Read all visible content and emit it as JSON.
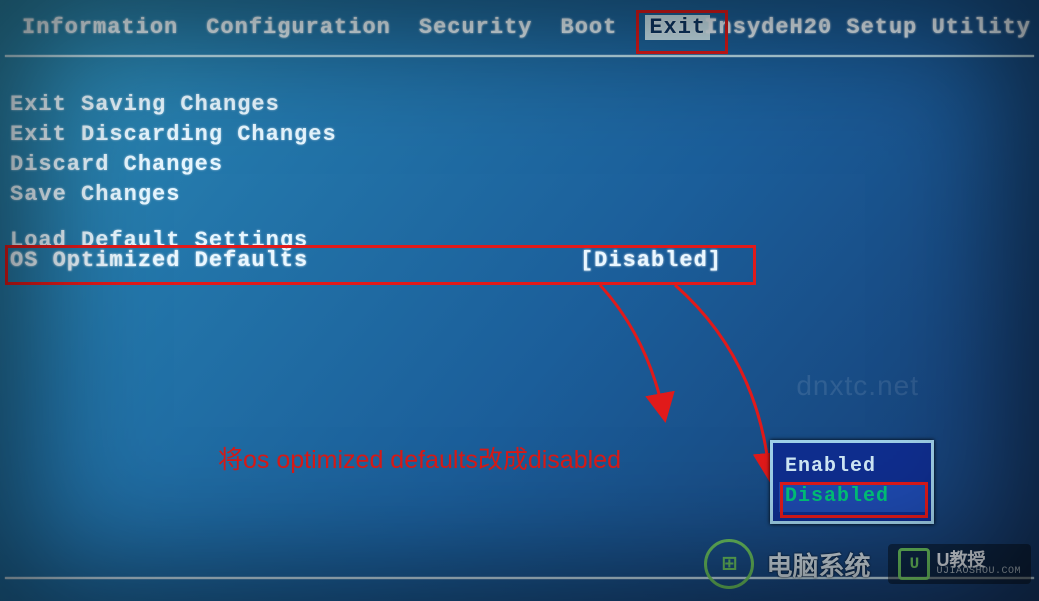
{
  "utility_title": "InsydeH20 Setup Utility",
  "menu": {
    "items": [
      "Information",
      "Configuration",
      "Security",
      "Boot",
      "Exit"
    ],
    "active_index": 4
  },
  "exit_options": {
    "group1": [
      "Exit Saving Changes",
      "Exit Discarding Changes",
      "Discard Changes",
      "Save Changes"
    ],
    "group2": [
      "Load Default Settings"
    ],
    "highlighted": {
      "label": "OS Optimized Defaults",
      "value": "[Disabled]"
    }
  },
  "popup": {
    "options": [
      "Enabled",
      "Disabled"
    ],
    "selected_index": 1
  },
  "annotation": "将os optimized defaults改成disabled",
  "watermark": {
    "faint": "dnxtc.net",
    "brand1": "电脑系统",
    "brand2_label": "U教授",
    "brand2_sub": "UJIAOSHOU.COM"
  },
  "colors": {
    "red": "#e11a1a",
    "bg_top": "#2f8fb4",
    "bg_bot": "#173a6b",
    "popup_bg": "#0f2e8f",
    "selected_green": "#00c47a"
  }
}
